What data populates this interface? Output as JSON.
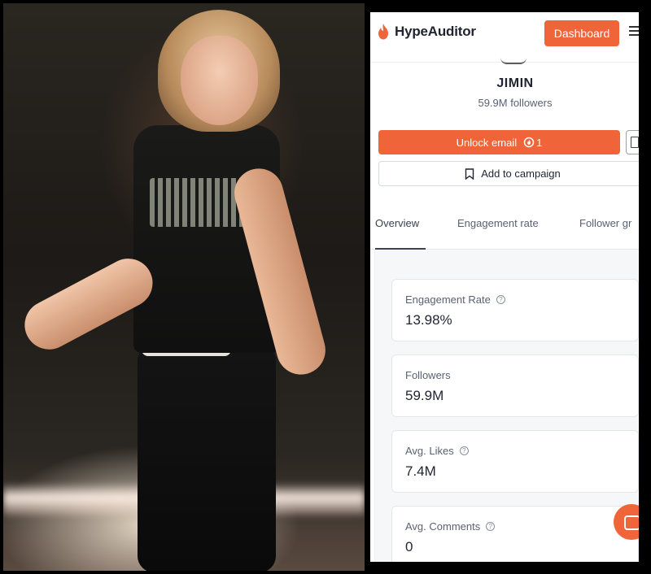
{
  "photo": {
    "description_icon": "concert-photo"
  },
  "app": {
    "brand": "HypeAuditor",
    "brand_color": "#f0643a",
    "dashboard_label": "Dashboard"
  },
  "profile": {
    "name": "JIMIN",
    "followers": "59.9M followers",
    "unlock_label": "Unlock email",
    "unlock_cost": "1",
    "add_campaign_label": "Add to campaign"
  },
  "tabs": [
    {
      "label": "Overview",
      "active": true
    },
    {
      "label": "Engagement rate",
      "active": false
    },
    {
      "label": "Follower gr",
      "active": false
    }
  ],
  "metrics": [
    {
      "label": "Engagement Rate",
      "value": "13.98%"
    },
    {
      "label": "Followers",
      "value": "59.9M"
    },
    {
      "label": "Avg. Likes",
      "value": "7.4M"
    },
    {
      "label": "Avg. Comments",
      "value": "0"
    }
  ]
}
